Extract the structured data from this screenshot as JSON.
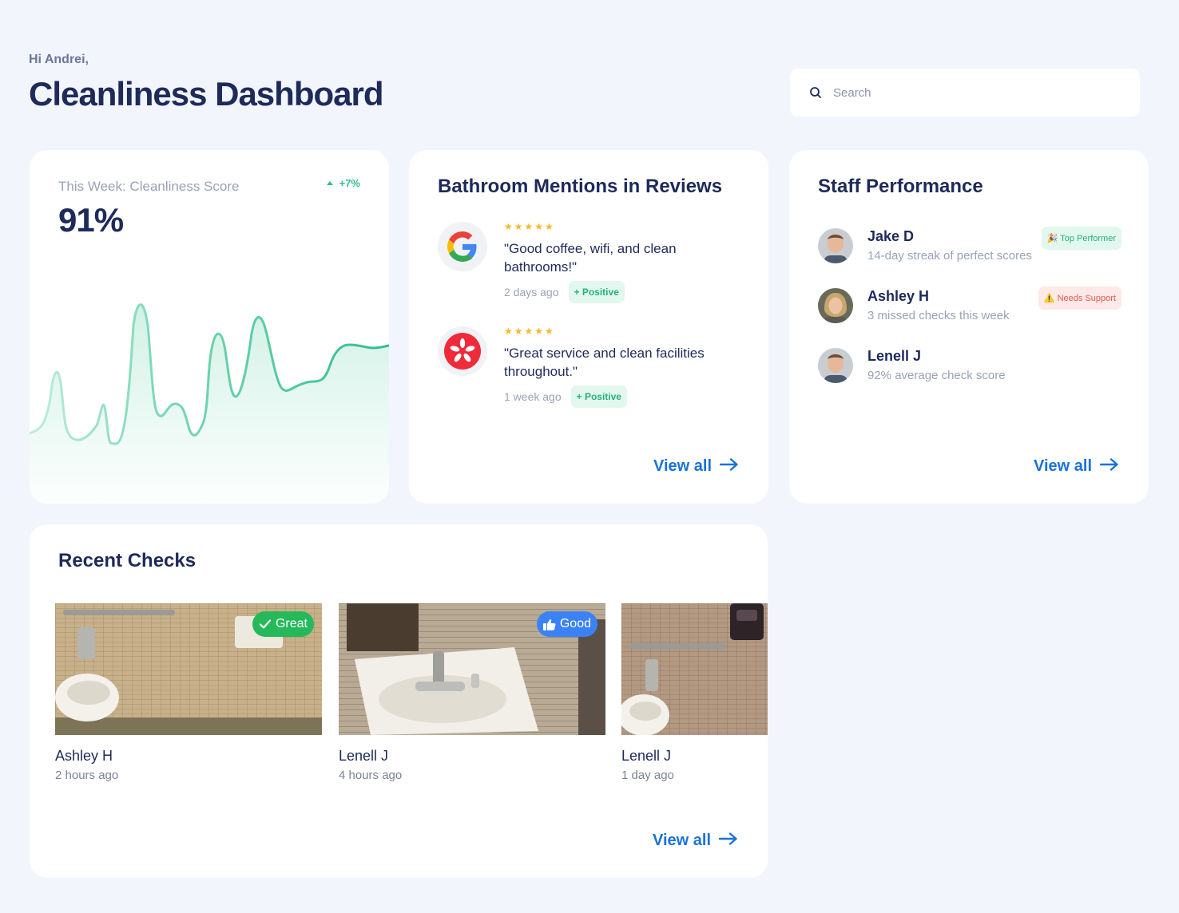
{
  "header": {
    "greeting": "Hi Andrei,",
    "title": "Cleanliness Dashboard"
  },
  "search": {
    "placeholder": "Search",
    "icon": "search-icon"
  },
  "score_card": {
    "label": "This Week: Cleanliness Score",
    "change": "+7%",
    "value": "91%",
    "accent": "#2cc08f"
  },
  "reviews": {
    "title": "Bathroom Mentions in Reviews",
    "items": [
      {
        "source_icon": "google-logo-icon",
        "stars": "★★★★★",
        "text": "\"Good coffee, wifi, and clean bathrooms!\"",
        "time": "2 days ago",
        "sentiment": "+ Positive"
      },
      {
        "source_icon": "yelp-logo-icon",
        "stars": "★★★★★",
        "text": "\"Great service and clean facilities throughout.\"",
        "time": "1 week ago",
        "sentiment": "+ Positive"
      }
    ],
    "view_all": "View all"
  },
  "staff": {
    "title": "Staff Performance",
    "items": [
      {
        "name": "Jake D",
        "sub": "14-day streak of perfect scores",
        "badge": "🎉 Top Performer"
      },
      {
        "name": "Ashley H",
        "sub": "3 missed checks this week",
        "badge": "⚠️ Needs Support"
      },
      {
        "name": "Lenell J",
        "sub": "92% average check score",
        "badge": ""
      }
    ],
    "view_all": "View all"
  },
  "checks": {
    "title": "Recent Checks",
    "items": [
      {
        "name": "Ashley H",
        "time": "2 hours ago",
        "badge": "Great"
      },
      {
        "name": "Lenell J",
        "time": "4 hours ago",
        "badge": "Good"
      },
      {
        "name": "Lenell J",
        "time": "1 day ago",
        "badge": ""
      }
    ],
    "view_all": "View all"
  },
  "colors": {
    "primary_text": "#1e2a5a",
    "link": "#1a72d9",
    "positive": "#27b180",
    "warning": "#e25a4f",
    "background": "#f2f5fc"
  }
}
